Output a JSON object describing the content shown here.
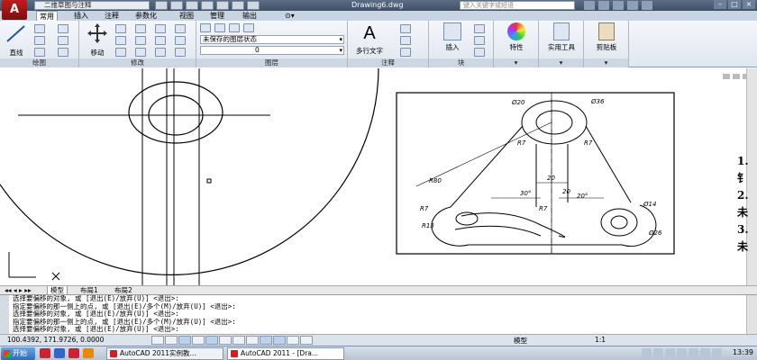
{
  "titlebar": {
    "workspace": "二维草图与注释",
    "document_title": "Drawing6.dwg",
    "search_placeholder": "键入关键字或短语"
  },
  "ribbon_tabs": [
    "常用",
    "插入",
    "注释",
    "参数化",
    "视图",
    "管理",
    "输出"
  ],
  "ribbon": {
    "draw": {
      "line_label": "直线",
      "footer": "绘图"
    },
    "modify": {
      "move_label": "移动",
      "footer": "修改"
    },
    "layers": {
      "state_value": "未保存的图层状态",
      "layer_value": "0",
      "footer": "图层"
    },
    "annotation": {
      "mtext_label": "多行文字",
      "footer": "注释"
    },
    "block": {
      "insert_label": "插入",
      "footer": "块"
    },
    "properties": {
      "label": "特性"
    },
    "utilities": {
      "label": "实用工具"
    },
    "clipboard": {
      "label": "剪贴板"
    }
  },
  "drawing": {
    "dimensions": [
      "Ø20",
      "Ø36",
      "R7",
      "R7",
      "R80",
      "20",
      "20",
      "30°",
      "20°",
      "R7",
      "R7",
      "R13",
      "Ø14",
      "Ø26"
    ],
    "right_list": [
      "1. 钅",
      "2. 未",
      "3. 未"
    ]
  },
  "layout_tabs": [
    "模型",
    "布局1",
    "布局2"
  ],
  "command_lines": [
    "选择要偏移的对象, 或 [退出(E)/放弃(U)] <退出>:",
    "指定要偏移的那一侧上的点, 或 [退出(E)/多个(M)/放弃(U)] <退出>:",
    "选择要偏移的对象, 或 [退出(E)/放弃(U)] <退出>:",
    "指定要偏移的那一侧上的点, 或 [退出(E)/多个(M)/放弃(U)] <退出>:",
    "选择要偏移的对象, 或 [退出(E)/放弃(U)] <退出>:"
  ],
  "statusbar": {
    "coordinates": "100.4392, 171.9726, 0.0000",
    "model_label": "模型",
    "anno_scale": "1:1"
  },
  "taskbar": {
    "start_label": "开始",
    "tasks": [
      "AutoCAD 2011实例教...",
      "AutoCAD 2011 - [Dra..."
    ],
    "clock": "13:39"
  }
}
